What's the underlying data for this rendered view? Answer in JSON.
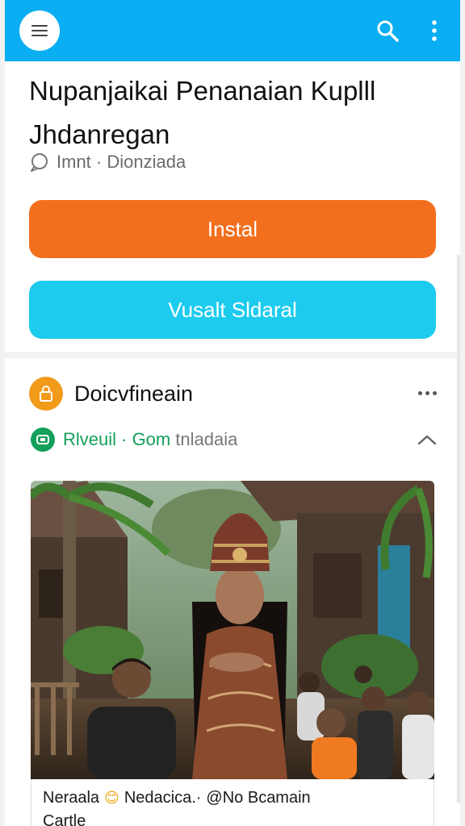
{
  "app_bar": {
    "background_color": "#0aaef2",
    "menu_icon": "hamburger-menu-icon",
    "search_icon": "search-icon",
    "overflow_icon": "vertical-dots-icon"
  },
  "article": {
    "title": "Nupanjaikai Penanaian Kuplll Jhdanregan",
    "meta_icon": "comment-bubble-icon",
    "meta_text": "Imnt · Dionziada"
  },
  "buttons": {
    "install": {
      "label": "Instal",
      "color": "#f26f1e"
    },
    "visual": {
      "label": "Vusalt Sldaral",
      "color": "#1dcbef"
    }
  },
  "post": {
    "author_icon": "lock-badge-icon",
    "author_name": "Doicvfineain",
    "more_icon": "horizontal-dots-icon",
    "tag_icon": "green-badge-icon",
    "tag_source": "Rlveuil · Gom",
    "tag_extra": "tnladaia",
    "collapse_icon": "chevron-up-icon",
    "photo_description_icon": "photo-image",
    "caption_line1_part1": "Neraala",
    "caption_emoji": "😊",
    "caption_line1_part2": "Nedacica.·",
    "caption_line1_part3": "@No Bcamain",
    "caption_line2": "Cartle"
  }
}
